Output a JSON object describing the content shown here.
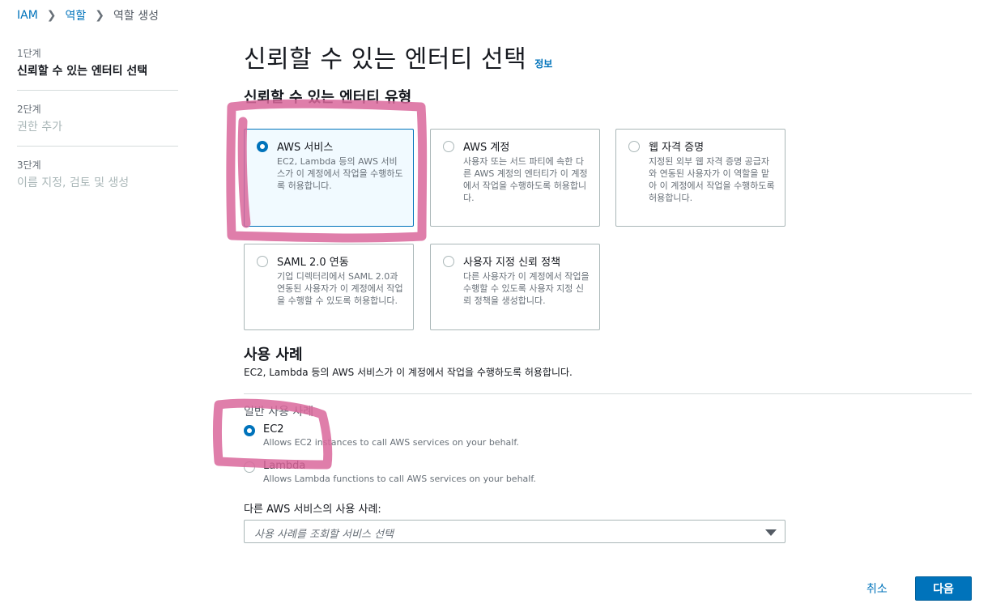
{
  "breadcrumb": {
    "items": [
      "IAM",
      "역할",
      "역할 생성"
    ]
  },
  "steps": [
    {
      "num": "1단계",
      "title": "신뢰할 수 있는 엔터티 선택"
    },
    {
      "num": "2단계",
      "title": "권한 추가"
    },
    {
      "num": "3단계",
      "title": "이름 지정, 검토 및 생성"
    }
  ],
  "page": {
    "title": "신뢰할 수 있는 엔터티 선택",
    "info": "정보"
  },
  "entity_section": {
    "title": "신뢰할 수 있는 엔터티 유형",
    "tiles": [
      {
        "title": "AWS 서비스",
        "desc": "EC2, Lambda 등의 AWS 서비스가 이 계정에서 작업을 수행하도록 허용합니다.",
        "selected": true
      },
      {
        "title": "AWS 계정",
        "desc": "사용자 또는 서드 파티에 속한 다른 AWS 계정의 엔터티가 이 계정에서 작업을 수행하도록 허용합니다.",
        "selected": false
      },
      {
        "title": "웹 자격 증명",
        "desc": "지정된 외부 웹 자격 증명 공급자와 연동된 사용자가 이 역할을 맡아 이 계정에서 작업을 수행하도록 허용합니다.",
        "selected": false
      },
      {
        "title": "SAML 2.0 연동",
        "desc": "기업 디렉터리에서 SAML 2.0과 연동된 사용자가 이 계정에서 작업을 수행할 수 있도록 허용합니다.",
        "selected": false
      },
      {
        "title": "사용자 지정 신뢰 정책",
        "desc": "다른 사용자가 이 계정에서 작업을 수행할 수 있도록 사용자 지정 신뢰 정책을 생성합니다.",
        "selected": false
      }
    ]
  },
  "use_case": {
    "title": "사용 사례",
    "desc": "EC2, Lambda 등의 AWS 서비스가 이 계정에서 작업을 수행하도록 허용합니다.",
    "common_label": "일반 사용 사례",
    "options": [
      {
        "label": "EC2",
        "desc": "Allows EC2 instances to call AWS services on your behalf.",
        "selected": true
      },
      {
        "label": "Lambda",
        "desc": "Allows Lambda functions to call AWS services on your behalf.",
        "selected": false
      }
    ],
    "other_label": "다른 AWS 서비스의 사용 사례:",
    "select_placeholder": "사용 사례를 조회할 서비스 선택"
  },
  "footer": {
    "cancel": "취소",
    "next": "다음"
  },
  "colors": {
    "accent": "#0073bb",
    "annotation": "#d9679b"
  }
}
